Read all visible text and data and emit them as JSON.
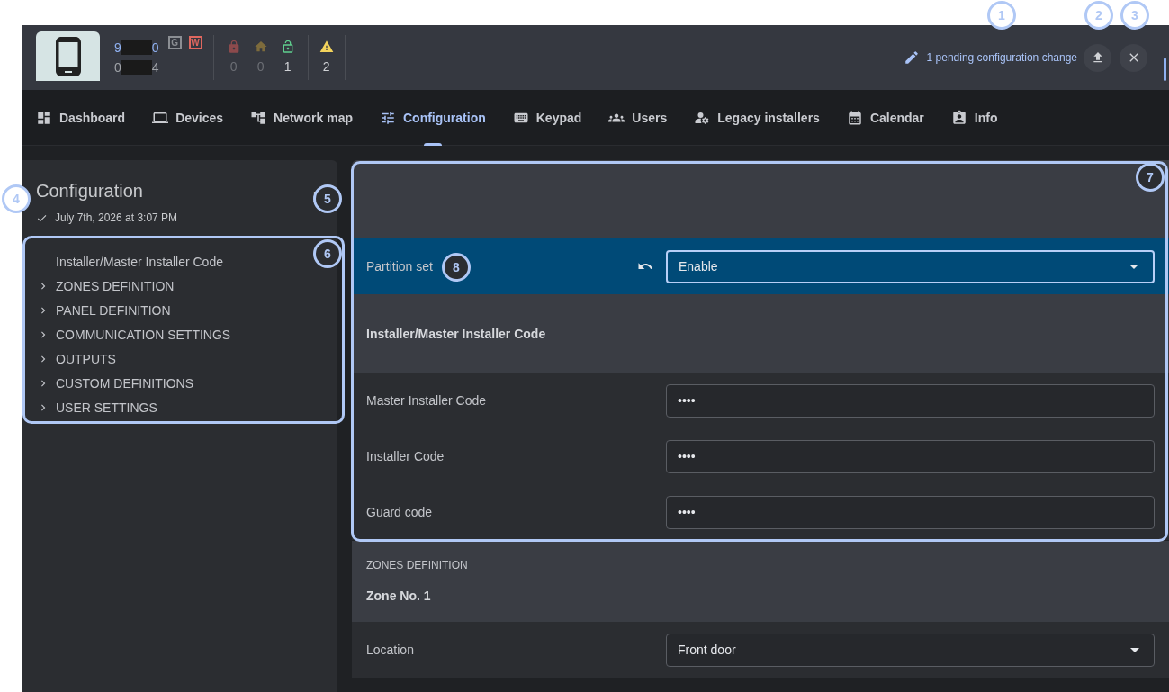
{
  "header": {
    "device": {
      "id_lines": [
        {
          "start": "9",
          "end": "0",
          "highlighted": true
        },
        {
          "start": "0",
          "end": "4",
          "highlighted": false
        }
      ],
      "badges": [
        {
          "text": "G",
          "color": "#8b8e93"
        },
        {
          "text": "W",
          "color": "#e0675f"
        }
      ]
    },
    "locks": [
      {
        "count": "0",
        "color": "#8c4a4c",
        "dimmed": true
      },
      {
        "count": "0",
        "color": "#7d6b3c",
        "dimmed": true
      },
      {
        "count": "1",
        "color": "#5fcf8e",
        "dimmed": false
      }
    ],
    "warnings": {
      "count": "2"
    },
    "pending": "1 pending configuration change"
  },
  "tabs": [
    {
      "label": "Dashboard",
      "selected": false
    },
    {
      "label": "Devices",
      "selected": false
    },
    {
      "label": "Network map",
      "selected": false
    },
    {
      "label": "Configuration",
      "selected": true
    },
    {
      "label": "Keypad",
      "selected": false
    },
    {
      "label": "Users",
      "selected": false
    },
    {
      "label": "Legacy installers",
      "selected": false
    },
    {
      "label": "Calendar",
      "selected": false
    },
    {
      "label": "Info",
      "selected": false
    }
  ],
  "sidebar": {
    "title": "Configuration",
    "saved": "July 7th, 2026 at 3:07 PM",
    "items": [
      {
        "label": "Installer/Master Installer Code",
        "expandable": false
      },
      {
        "label": "ZONES DEFINITION",
        "expandable": true
      },
      {
        "label": "PANEL DEFINITION",
        "expandable": true
      },
      {
        "label": "COMMUNICATION SETTINGS",
        "expandable": true
      },
      {
        "label": "OUTPUTS",
        "expandable": true
      },
      {
        "label": "CUSTOM DEFINITIONS",
        "expandable": true
      },
      {
        "label": "USER SETTINGS",
        "expandable": true
      }
    ]
  },
  "main": {
    "rows": [
      {
        "kind": "select",
        "label": "Partition set",
        "value": "Enable",
        "modified": true
      },
      {
        "kind": "heading",
        "text": "Installer/Master Installer Code"
      },
      {
        "kind": "password",
        "label": "Master Installer Code",
        "value": "••••",
        "modified": false
      },
      {
        "kind": "password",
        "label": "Installer Code",
        "value": "••••",
        "modified": false
      },
      {
        "kind": "password",
        "label": "Guard code",
        "value": "••••",
        "modified": false
      },
      {
        "kind": "section",
        "caption": "ZONES DEFINITION",
        "text": "Zone No. 1"
      },
      {
        "kind": "select",
        "label": "Location",
        "value": "Front door",
        "modified": false
      }
    ]
  },
  "callouts": [
    {
      "number": "1"
    },
    {
      "number": "2"
    },
    {
      "number": "3"
    },
    {
      "number": "4"
    },
    {
      "number": "5"
    },
    {
      "number": "6"
    },
    {
      "number": "7"
    },
    {
      "number": "8"
    }
  ]
}
